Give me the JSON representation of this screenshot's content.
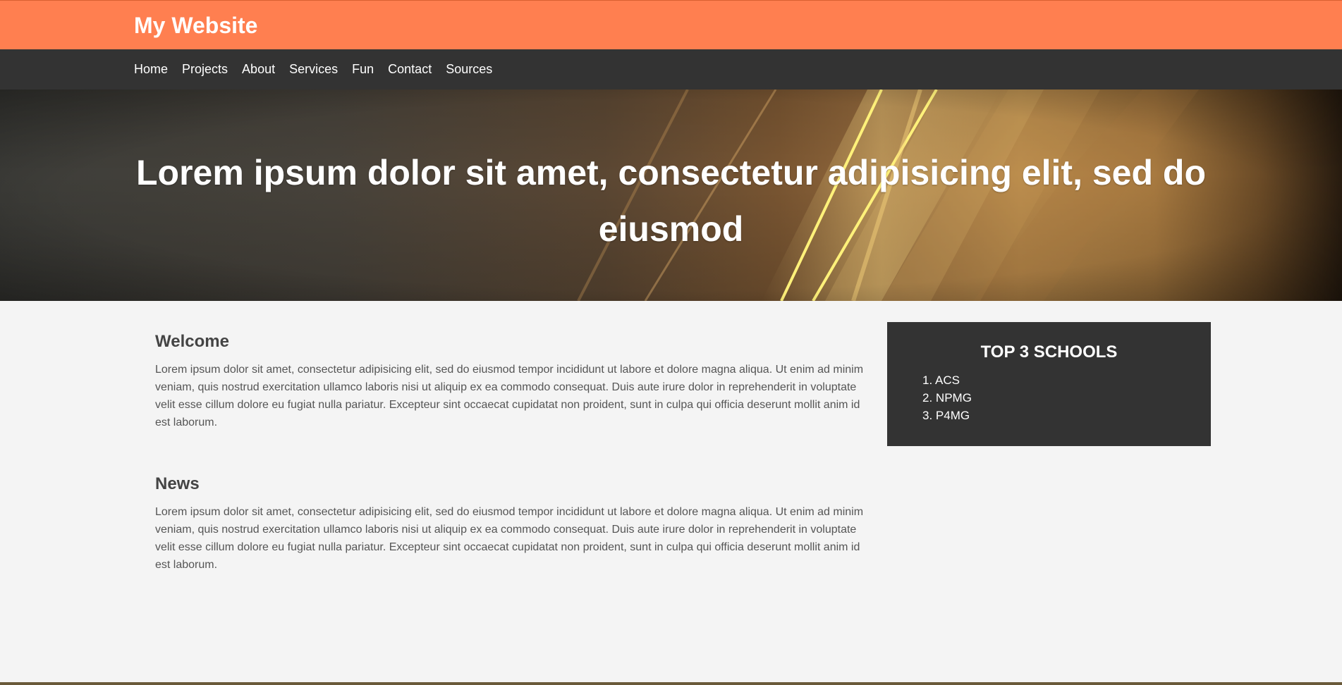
{
  "header": {
    "brand": "My Website"
  },
  "nav": {
    "items": [
      {
        "label": "Home"
      },
      {
        "label": "Projects"
      },
      {
        "label": "About"
      },
      {
        "label": "Services"
      },
      {
        "label": "Fun"
      },
      {
        "label": "Contact"
      },
      {
        "label": "Sources"
      }
    ]
  },
  "hero": {
    "title": "Lorem ipsum dolor sit amet, consectetur adipisicing elit, sed do eiusmod"
  },
  "main": {
    "sections": [
      {
        "heading": "Welcome",
        "body": "Lorem ipsum dolor sit amet, consectetur adipisicing elit, sed do eiusmod tempor incididunt ut labore et dolore magna aliqua. Ut enim ad minim veniam, quis nostrud exercitation ullamco laboris nisi ut aliquip ex ea commodo consequat. Duis aute irure dolor in reprehenderit in voluptate velit esse cillum dolore eu fugiat nulla pariatur. Excepteur sint occaecat cupidatat non proident, sunt in culpa qui officia deserunt mollit anim id est laborum."
      },
      {
        "heading": "News",
        "body": "Lorem ipsum dolor sit amet, consectetur adipisicing elit, sed do eiusmod tempor incididunt ut labore et dolore magna aliqua. Ut enim ad minim veniam, quis nostrud exercitation ullamco laboris nisi ut aliquip ex ea commodo consequat. Duis aute irure dolor in reprehenderit in voluptate velit esse cillum dolore eu fugiat nulla pariatur. Excepteur sint occaecat cupidatat non proident, sunt in culpa qui officia deserunt mollit anim id est laborum."
      }
    ]
  },
  "sidebar": {
    "title": "TOP 3 SCHOOLS",
    "items": [
      {
        "num": "1.",
        "label": "ACS"
      },
      {
        "num": "2.",
        "label": "NPMG"
      },
      {
        "num": "3.",
        "label": "P4MG"
      }
    ]
  },
  "colors": {
    "accent": "#ff7f50",
    "nav_bg": "#333333",
    "page_bg": "#f4f4f4"
  }
}
